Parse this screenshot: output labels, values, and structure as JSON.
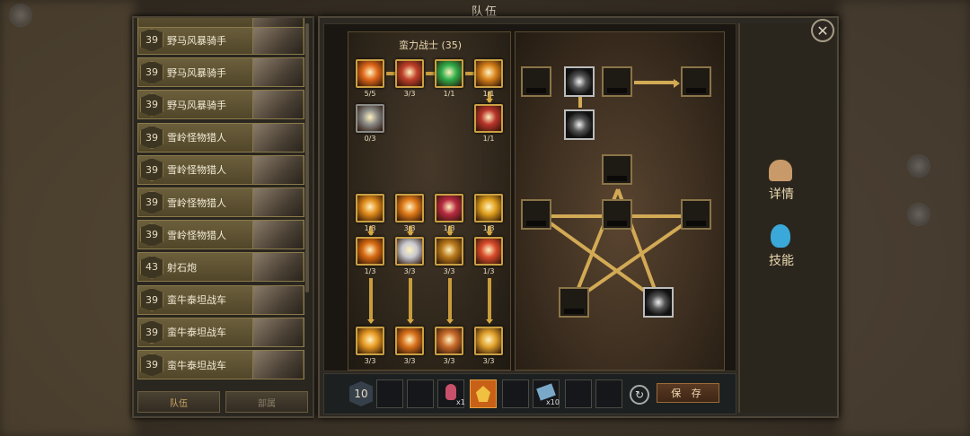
{
  "window": {
    "title": "队伍"
  },
  "roster": {
    "units": [
      {
        "level": "39",
        "name": "野马风暴骑手"
      },
      {
        "level": "39",
        "name": "野马风暴骑手"
      },
      {
        "level": "39",
        "name": "野马风暴骑手"
      },
      {
        "level": "39",
        "name": "雪岭怪物猎人"
      },
      {
        "level": "39",
        "name": "雪岭怪物猎人"
      },
      {
        "level": "39",
        "name": "雪岭怪物猎人"
      },
      {
        "level": "39",
        "name": "雪岭怪物猎人"
      },
      {
        "level": "43",
        "name": "射石炮"
      },
      {
        "level": "39",
        "name": "蛮牛泰坦战车"
      },
      {
        "level": "39",
        "name": "蛮牛泰坦战车"
      },
      {
        "level": "39",
        "name": "蛮牛泰坦战车"
      }
    ],
    "tabs": [
      "队伍",
      "部属"
    ]
  },
  "tree": {
    "title": "蛮力战士 (35)",
    "skills": [
      {
        "count": "5/5",
        "color": "#e0681a"
      },
      {
        "count": "3/3",
        "color": "#c0402a"
      },
      {
        "count": "1/1",
        "color": "#2fae4a"
      },
      {
        "count": "1/1",
        "color": "#d8821a"
      },
      {
        "count": "0/3",
        "color": "#8a8a86"
      },
      {
        "count": "1/1",
        "color": "#b8342a"
      },
      {
        "count": "1/3",
        "color": "#e08a1a"
      },
      {
        "count": "3/3",
        "color": "#e07a18"
      },
      {
        "count": "1/3",
        "color": "#b82a40"
      },
      {
        "count": "1/3",
        "color": "#e0a01c"
      },
      {
        "count": "1/3",
        "color": "#d86a12"
      },
      {
        "count": "3/3",
        "color": "#c8c8d0"
      },
      {
        "count": "3/3",
        "color": "#b8781a"
      },
      {
        "count": "1/3",
        "color": "#d84a2a"
      },
      {
        "count": "3/3",
        "color": "#e89a22"
      },
      {
        "count": "3/3",
        "color": "#d8701a"
      },
      {
        "count": "3/3",
        "color": "#c86a2a"
      },
      {
        "count": "3/3",
        "color": "#e0a02a"
      }
    ]
  },
  "side": {
    "details": "详情",
    "skills": "技能"
  },
  "bottom": {
    "level": "10",
    "potion_qty": "x1",
    "scroll_qty": "x10",
    "save": "保 存"
  }
}
